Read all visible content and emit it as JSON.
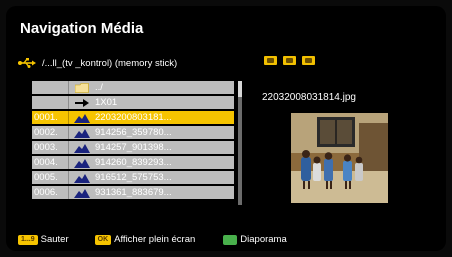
{
  "title": "Navigation Média",
  "path": "/...ll_(tv _kontrol) (memory stick)",
  "mode_icons": [
    "photo-mode-icon",
    "music-mode-icon",
    "video-mode-icon"
  ],
  "colors": {
    "selection": "#f6c400",
    "row": "#bdbdbd",
    "green_button": "#49b04c"
  },
  "list": [
    {
      "index": "",
      "icon": "folder-icon",
      "name": "../"
    },
    {
      "index": "",
      "icon": "arrow-right-icon",
      "name": "1X01"
    },
    {
      "index": "0001.",
      "icon": "image-file-icon",
      "name": "2203200803181...",
      "selected": true
    },
    {
      "index": "0002.",
      "icon": "image-file-icon",
      "name": "914256_359780..."
    },
    {
      "index": "0003.",
      "icon": "image-file-icon",
      "name": "914257_901398..."
    },
    {
      "index": "0004.",
      "icon": "image-file-icon",
      "name": "914260_839293..."
    },
    {
      "index": "0005.",
      "icon": "image-file-icon",
      "name": "916512_575753..."
    },
    {
      "index": "0006.",
      "icon": "image-file-icon",
      "name": "931361_883679..."
    }
  ],
  "preview": {
    "filename": "22032008031814.jpg"
  },
  "legend": {
    "jump_key": "1...9",
    "jump_label": "Sauter",
    "ok_key": "OK",
    "ok_label": "Afficher plein écran",
    "green_label": "Diaporama"
  }
}
